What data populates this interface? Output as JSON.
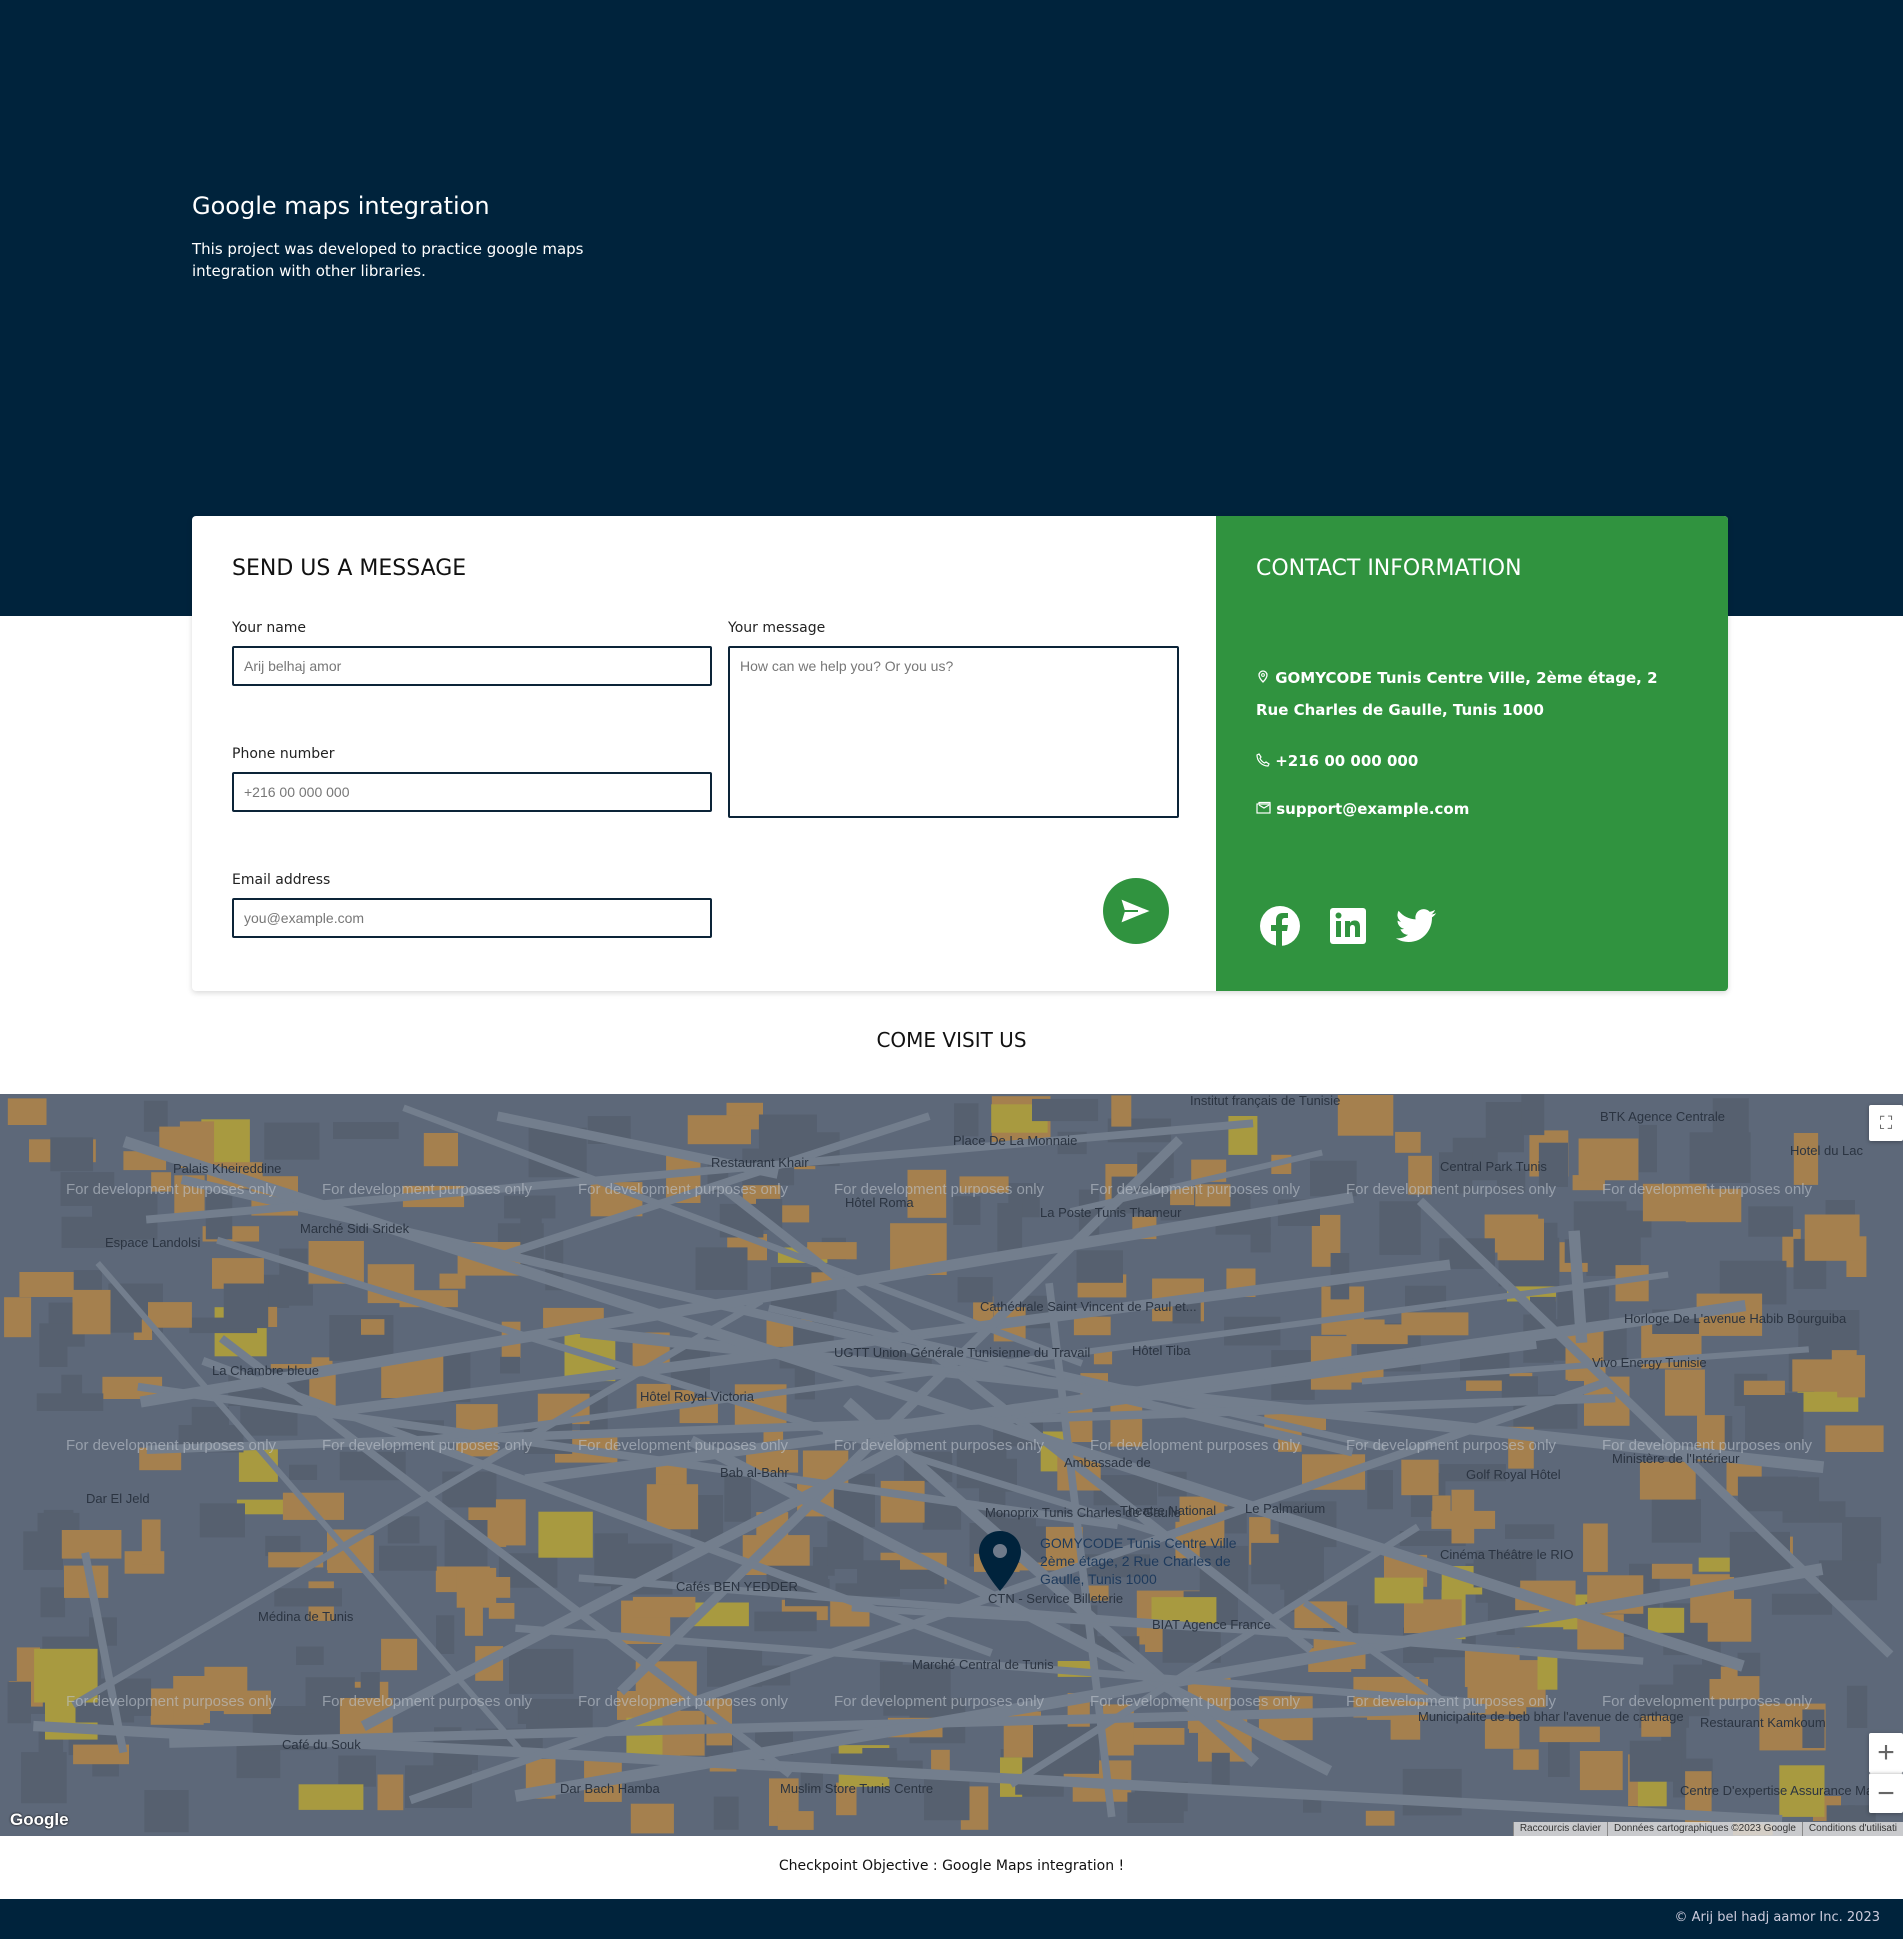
{
  "hero": {
    "title": "Google maps integration",
    "description": "This project was developed to practice google maps integration with other libraries."
  },
  "form": {
    "title": "SEND US A MESSAGE",
    "name_label": "Your name",
    "name_placeholder": "Arij belhaj amor",
    "phone_label": "Phone number",
    "phone_placeholder": "+216 00 000 000",
    "email_label": "Email address",
    "email_placeholder": "you@example.com",
    "message_label": "Your message",
    "message_placeholder": "How can we help you? Or you us?",
    "send_icon": "paper-plane-icon"
  },
  "contact": {
    "title": "CONTACT INFORMATION",
    "address": "GOMYCODE Tunis Centre Ville, 2ème étage, 2 Rue Charles de Gaulle, Tunis 1000",
    "phone": "+216 00 000 000",
    "email": "support@example.com",
    "socials": [
      "facebook-icon",
      "linkedin-icon",
      "twitter-icon"
    ]
  },
  "visit_title": "COME VISIT US",
  "map": {
    "watermark": "For development purposes only",
    "labels": [
      "Palais Kheireddine",
      "Restaurant Khair",
      "Place De La Monnaie",
      "Institut français de Tunisie",
      "Central Park Tunis",
      "BTK Agence Centrale",
      "Hôtel Roma",
      "La Poste Tunis Thameur",
      "Marché Sidi Sridek",
      "Espace Landolsi",
      "Cathédrale Saint Vincent de Paul et...",
      "Hôtel Tiba",
      "UGTT Union Générale Tunisienne du Travail",
      "La Chambre bleue",
      "Hôtel Royal Victoria",
      "Dar El Jeld",
      "Le Palmarium",
      "Monoprix Tunis Charles de Gaulle",
      "CTN - Service Billeterie",
      "Cinéma Théâtre le RIO",
      "Golf Royal Hôtel",
      "Médina de Tunis",
      "Café du Souk",
      "Marché Central de Tunis",
      "Theatre National",
      "Cafés BEN YEDDER",
      "Bab al-Bahr",
      "Municipalite de beb bhar l'avenue de carthage",
      "Restaurant Kamkoum",
      "Centre D'expertise Assurance Maghrebia",
      "Muslim Store Tunis Centre",
      "Dar Bach Hamba",
      "Ministère de l'Intérieur",
      "Horloge De L'avenue Habib Bourguiba",
      "Vivo Energy Tunisie",
      "Hotel du Lac",
      "BIAT Agence France",
      "Ambassade de"
    ],
    "marker_label": "GOMYCODE Tunis Centre Ville 2ème étage, 2 Rue Charles de Gaulle, Tunis 1000",
    "logo": "Google",
    "attribution": [
      "Raccourcis clavier",
      "Données cartographiques ©2023 Google",
      "Conditions d'utilisati"
    ],
    "zoom_in": "+",
    "zoom_out": "−",
    "marker_color": "#00233c"
  },
  "footer": {
    "objective": "Checkpoint Objective : Google Maps integration !",
    "copyright": "© Arij bel hadj aamor Inc. 2023"
  },
  "colors": {
    "navy": "#00233c",
    "green": "#30933f"
  }
}
